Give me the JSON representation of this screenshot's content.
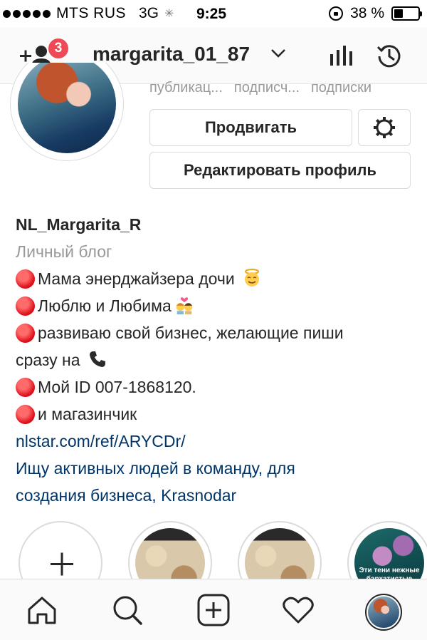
{
  "status_bar": {
    "carrier": "MTS RUS",
    "network": "3G",
    "time": "9:25",
    "battery": "38 %",
    "battery_level": 0.38
  },
  "header": {
    "notification_count": "3",
    "username": "margarita_01_87"
  },
  "profile": {
    "stat_labels": [
      "публикац...",
      "подписч...",
      "подписки"
    ],
    "promote_label": "Продвигать",
    "edit_label": "Редактировать профиль"
  },
  "bio": {
    "name": "NL_Margarita_R",
    "category": "Личный блог",
    "lines": [
      "Мама энерджайзера дочи",
      "Люблю и Любима",
      "развиваю свой бизнес, желающие пиши",
      "сразу на",
      "Мой ID 007-1868120.",
      "и магазинчик"
    ],
    "link": "nlstar.com/ref/ARYCDr/",
    "blue_text_1": "Ищу активных людей в команду, для",
    "blue_text_2": "создания бизнеса, Krasnodar"
  },
  "highlights": {
    "caption": "Эти тени нежные бархатистые"
  },
  "colors": {
    "badge": "#ed4956",
    "link": "#003569",
    "muted": "#999999"
  }
}
